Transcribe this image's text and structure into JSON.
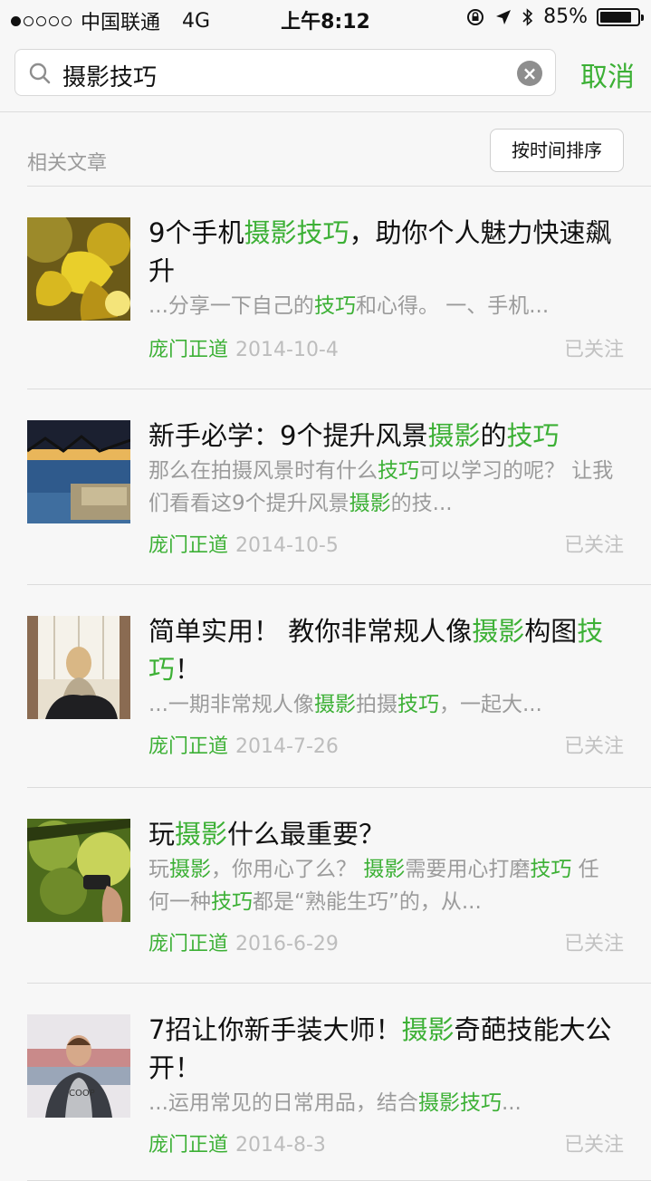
{
  "status": {
    "carrier": "中国联通",
    "network": "4G",
    "time": "上午8:12",
    "battery": "85%"
  },
  "search": {
    "query": "摄影技巧",
    "cancel_label": "取消"
  },
  "section": {
    "label": "相关文章",
    "sort_label": "按时间排序"
  },
  "colors": {
    "accent": "#3cb035",
    "muted": "#9b9b9b"
  },
  "articles": [
    {
      "title_parts": [
        [
          "9个手机",
          false
        ],
        [
          "摄影技巧",
          true
        ],
        [
          "，助你个人魅力快速飙升",
          false
        ]
      ],
      "desc_parts": [
        [
          "...分享一下自己的",
          false
        ],
        [
          "技巧",
          true
        ],
        [
          "和心得。 一、手机...",
          false
        ]
      ],
      "source": "庞门正道",
      "date": "2014-10-4",
      "follow": "已关注",
      "thumb": "ginkgo-leaves"
    },
    {
      "title_parts": [
        [
          "新手必学：9个提升风景",
          false
        ],
        [
          "摄影",
          true
        ],
        [
          "的",
          false
        ],
        [
          "技巧",
          true
        ]
      ],
      "desc_parts": [
        [
          "那么在拍摄风景时有什么",
          false
        ],
        [
          "技巧",
          true
        ],
        [
          "可以学习的呢？ 让我们看看这9个提升风景",
          false
        ],
        [
          "摄影",
          true
        ],
        [
          "的技...",
          false
        ]
      ],
      "source": "庞门正道",
      "date": "2014-10-5",
      "follow": "已关注",
      "thumb": "city-night-bridge"
    },
    {
      "title_parts": [
        [
          "简单实用！ 教你非常规人像",
          false
        ],
        [
          "摄影",
          true
        ],
        [
          "构图",
          false
        ],
        [
          "技巧",
          true
        ],
        [
          "！",
          false
        ]
      ],
      "desc_parts": [
        [
          "...一期非常规人像",
          false
        ],
        [
          "摄影",
          true
        ],
        [
          "拍摄",
          false
        ],
        [
          "技巧",
          true
        ],
        [
          "，一起大...",
          false
        ]
      ],
      "source": "庞门正道",
      "date": "2014-7-26",
      "follow": "已关注",
      "thumb": "woman-with-cat"
    },
    {
      "title_parts": [
        [
          "玩",
          false
        ],
        [
          "摄影",
          true
        ],
        [
          "什么最重要？",
          false
        ]
      ],
      "desc_parts": [
        [
          "玩",
          false
        ],
        [
          "摄影",
          true
        ],
        [
          "，你用心了么？ ",
          false
        ],
        [
          "摄影",
          true
        ],
        [
          "需要用心打磨",
          false
        ],
        [
          "技巧",
          true
        ],
        [
          " 任何一种",
          false
        ],
        [
          "技巧",
          true
        ],
        [
          "都是“熟能生巧”的，从...",
          false
        ]
      ],
      "source": "庞门正道",
      "date": "2016-6-29",
      "follow": "已关注",
      "thumb": "camera-in-forest"
    },
    {
      "title_parts": [
        [
          "7招让你新手装大师！",
          false
        ],
        [
          "摄影",
          true
        ],
        [
          "奇葩技能大公开！",
          false
        ]
      ],
      "desc_parts": [
        [
          "...运用常见的日常用品，结合",
          false
        ],
        [
          "摄影技巧",
          true
        ],
        [
          "...",
          false
        ]
      ],
      "source": "庞门正道",
      "date": "2014-8-3",
      "follow": "已关注",
      "thumb": "man-portrait"
    }
  ]
}
